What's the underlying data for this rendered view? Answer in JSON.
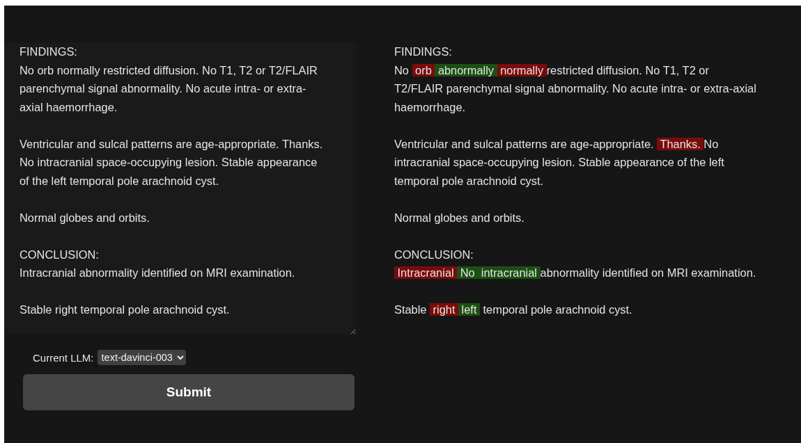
{
  "editor": {
    "value": "FINDINGS:\nNo orb normally restricted diffusion. No T1, T2 or T2/FLAIR parenchymal signal abnormality. No acute intra- or extra-axial haemorrhage.\n\nVentricular and sulcal patterns are age-appropriate. Thanks. No intracranial space-occupying lesion. Stable appearance of the left temporal pole arachnoid cyst.\n\nNormal globes and orbits.\n\nCONCLUSION:\nIntracranial abnormality identified on MRI examination.\n\nStable right temporal pole arachnoid cyst."
  },
  "model_select": {
    "label": "Current LLM:",
    "value": "text-davinci-003"
  },
  "submit": {
    "label": "Submit"
  },
  "diff": {
    "paragraphs": [
      [
        {
          "kind": "same",
          "text": "FINDINGS:\nNo "
        },
        {
          "kind": "removed",
          "text": " orb "
        },
        {
          "kind": "added",
          "text": " abnormally "
        },
        {
          "kind": "removed",
          "text": " normally "
        },
        {
          "kind": "same",
          "text": "restricted diffusion. No T1, T2 or T2/FLAIR parenchymal signal abnormality. No acute intra- or extra-axial haemorrhage."
        }
      ],
      [
        {
          "kind": "same",
          "text": "Ventricular and sulcal patterns are age-appropriate. "
        },
        {
          "kind": "removed",
          "text": " Thanks. "
        },
        {
          "kind": "same",
          "text": "No intracranial space-occupying lesion. Stable appearance of the left temporal pole arachnoid cyst."
        }
      ],
      [
        {
          "kind": "same",
          "text": "Normal globes and orbits."
        }
      ],
      [
        {
          "kind": "same",
          "text": "CONCLUSION:\n"
        },
        {
          "kind": "removed",
          "text": " Intracranial "
        },
        {
          "kind": "added",
          "text": " No "
        },
        {
          "kind": "added",
          "text": " intracranial "
        },
        {
          "kind": "same",
          "text": "abnormality identified on MRI examination."
        }
      ],
      [
        {
          "kind": "same",
          "text": "Stable "
        },
        {
          "kind": "removed",
          "text": " right "
        },
        {
          "kind": "added",
          "text": " left "
        },
        {
          "kind": "same",
          "text": " temporal pole arachnoid cyst."
        }
      ]
    ]
  }
}
